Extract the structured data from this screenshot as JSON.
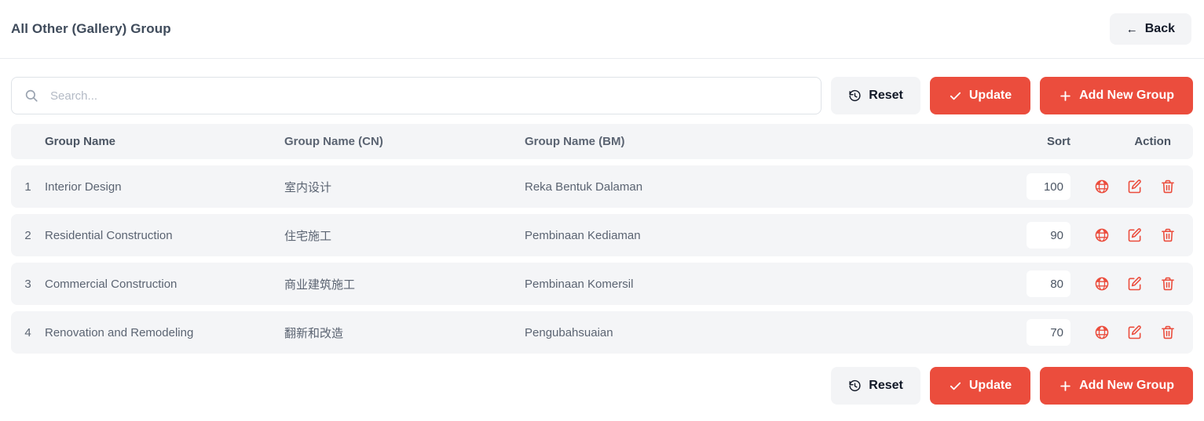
{
  "header": {
    "title": "All Other (Gallery) Group",
    "back_label": "Back",
    "back_icon": "arrow-left-icon"
  },
  "toolbar": {
    "search_placeholder": "Search...",
    "search_value": "",
    "search_icon": "search-icon",
    "reset_label": "Reset",
    "reset_icon": "clock-rotate-left-icon",
    "update_label": "Update",
    "update_icon": "check-icon",
    "add_label": "Add New Group",
    "add_icon": "plus-icon"
  },
  "table": {
    "columns": {
      "index": "",
      "name": "Group Name",
      "name_cn": "Group Name (CN)",
      "name_bm": "Group Name (BM)",
      "sort": "Sort",
      "action": "Action"
    },
    "row_icons": {
      "translate": "globe-icon",
      "edit": "pen-to-square-icon",
      "delete": "trash-icon"
    },
    "rows": [
      {
        "index": "1",
        "name": "Interior Design",
        "name_cn": "室内设计",
        "name_bm": "Reka Bentuk Dalaman",
        "sort": "100"
      },
      {
        "index": "2",
        "name": "Residential Construction",
        "name_cn": "住宅施工",
        "name_bm": "Pembinaan Kediaman",
        "sort": "90"
      },
      {
        "index": "3",
        "name": "Commercial Construction",
        "name_cn": "商业建筑施工",
        "name_bm": "Pembinaan Komersil",
        "sort": "80"
      },
      {
        "index": "4",
        "name": "Renovation and Remodeling",
        "name_cn": "翻新和改造",
        "name_bm": "Pengubahsuaian",
        "sort": "70"
      }
    ]
  },
  "footer": {
    "reset_label": "Reset",
    "update_label": "Update",
    "add_label": "Add New Group"
  },
  "colors": {
    "accent_red": "#eb4d3d",
    "row_bg": "#f4f5f7",
    "light_button": "#f3f4f6",
    "title_text": "#3f4b5b"
  }
}
